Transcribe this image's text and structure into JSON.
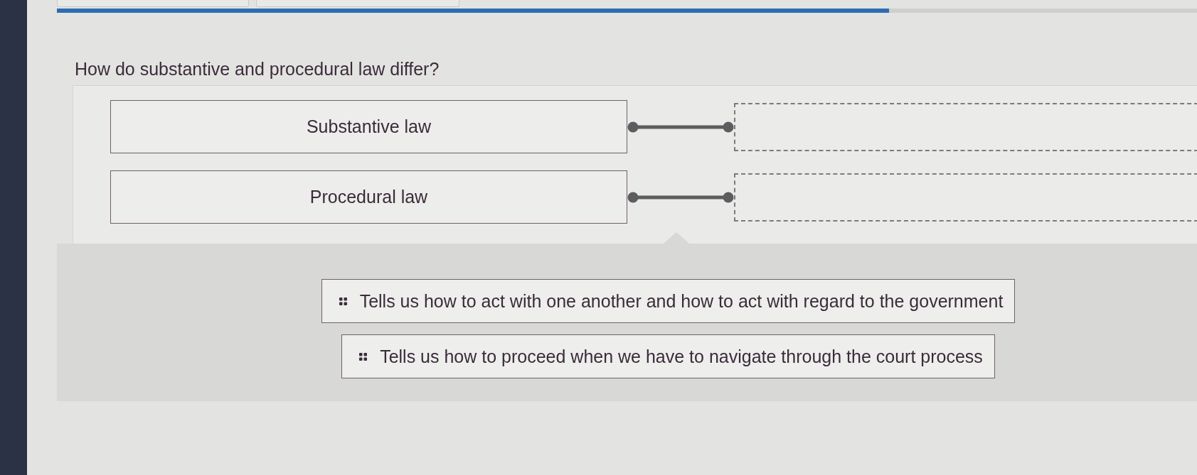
{
  "progress": {
    "level": 0.73
  },
  "question": "How do substantive and procedural law differ?",
  "premises": [
    {
      "label": "Substantive law"
    },
    {
      "label": "Procedural law"
    }
  ],
  "options": [
    {
      "label": "Tells us how to act with one another and how to act with regard to the government"
    },
    {
      "label": "Tells us how to proceed when we have to navigate through the court process"
    }
  ]
}
